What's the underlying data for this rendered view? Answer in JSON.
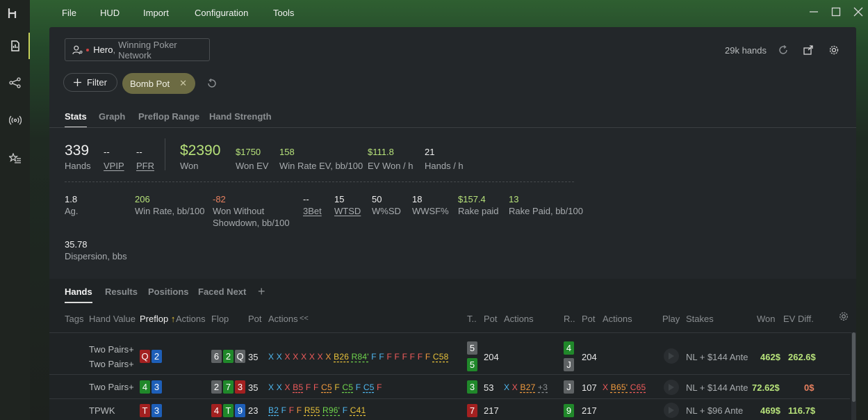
{
  "menu": {
    "file": "File",
    "hud": "HUD",
    "import": "Import",
    "configuration": "Configuration",
    "tools": "Tools"
  },
  "player": {
    "name": "Hero",
    "network": "Winning Poker Network",
    "hands_count": "29k hands"
  },
  "filter": {
    "filter_label": "Filter",
    "chip_label": "Bomb Pot"
  },
  "stats_tabs": [
    "Stats",
    "Graph",
    "Preflop Range",
    "Hand Strength"
  ],
  "stats_row1": [
    {
      "value": "339",
      "label": "Hands"
    },
    {
      "value": "--",
      "label": "VPIP"
    },
    {
      "value": "--",
      "label": "PFR"
    },
    {
      "value": "$2390",
      "label": "Won"
    },
    {
      "value": "$1750",
      "label": "Won EV"
    },
    {
      "value": "158",
      "label": "Win Rate EV, bb/100"
    },
    {
      "value": "$111.8",
      "label": "EV Won / h"
    },
    {
      "value": "21",
      "label": "Hands / h"
    }
  ],
  "stats_row2": [
    {
      "value": "1.8",
      "label": "Ag."
    },
    {
      "value": "206",
      "label": "Win Rate, bb/100"
    },
    {
      "value": "-82",
      "label": "Won Without",
      "label2": "Showdown, bb/100"
    },
    {
      "value": "--",
      "label": "3Bet"
    },
    {
      "value": "15",
      "label": "WTSD"
    },
    {
      "value": "50",
      "label": "W%SD"
    },
    {
      "value": "18",
      "label": "WWSF%"
    },
    {
      "value": "$157.4",
      "label": "Rake paid"
    },
    {
      "value": "13",
      "label": "Rake Paid, bb/100"
    }
  ],
  "stats_row3": [
    {
      "value": "35.78",
      "label": "Dispersion, bbs"
    }
  ],
  "hands_tabs": [
    "Hands",
    "Results",
    "Positions",
    "Faced Next"
  ],
  "columns": {
    "tags": "Tags",
    "hand_value": "Hand Value",
    "preflop": "Preflop",
    "preflop_sort": "↑",
    "actions1": "Actions",
    "flop": "Flop",
    "pot1": "Pot",
    "actions2": "Actions",
    "collapse": "<<",
    "turn": "T..",
    "pot2": "Pot",
    "actions3": "Actions",
    "river": "R..",
    "pot3": "Pot",
    "actions4": "Actions",
    "play": "Play",
    "stakes": "Stakes",
    "won": "Won",
    "ev_diff": "EV Diff."
  },
  "rows": [
    {
      "hand_value_a": "Two Pairs+",
      "hand_value_b": "Two Pairs+",
      "preflop": [
        {
          "r": "Q",
          "c": "red"
        },
        {
          "r": "2",
          "c": "blue"
        }
      ],
      "flop": [
        {
          "r": "6",
          "c": "gray"
        },
        {
          "r": "2",
          "c": "green"
        },
        {
          "r": "Q",
          "c": "gray"
        }
      ],
      "pot1": "35",
      "flop_actions": [
        {
          "t": "X",
          "k": "x"
        },
        {
          "t": "X",
          "k": "x"
        },
        {
          "t": "X",
          "k": "r"
        },
        {
          "t": "X",
          "k": "r"
        },
        {
          "t": "X",
          "k": "r"
        },
        {
          "t": "X",
          "k": "r"
        },
        {
          "t": "X",
          "k": "r"
        },
        {
          "t": "X",
          "k": "o"
        },
        {
          "t": "B26",
          "k": "b"
        },
        {
          "t": "R84'",
          "k": "g"
        },
        {
          "t": "F",
          "k": "x"
        },
        {
          "t": "F",
          "k": "x"
        },
        {
          "t": "F",
          "k": "r"
        },
        {
          "t": "F",
          "k": "r"
        },
        {
          "t": "F",
          "k": "r"
        },
        {
          "t": "F",
          "k": "r"
        },
        {
          "t": "F",
          "k": "r"
        },
        {
          "t": "F",
          "k": "o"
        },
        {
          "t": "C58",
          "k": "b"
        }
      ],
      "turn_a": {
        "r": "5",
        "c": "gray"
      },
      "turn_b": {
        "r": "5",
        "c": "green"
      },
      "pot2": "204",
      "river_a": {
        "r": "4",
        "c": "green"
      },
      "river_b": {
        "r": "J",
        "c": "gray"
      },
      "pot3": "204",
      "stakes": "NL + $144 Ante",
      "won": "462$",
      "ev_diff": "262.6$"
    },
    {
      "hand_value_a": "Two Pairs+",
      "preflop": [
        {
          "r": "4",
          "c": "green"
        },
        {
          "r": "3",
          "c": "blue"
        }
      ],
      "flop": [
        {
          "r": "2",
          "c": "gray"
        },
        {
          "r": "7",
          "c": "green"
        },
        {
          "r": "3",
          "c": "red"
        }
      ],
      "pot1": "35",
      "flop_actions": [
        {
          "t": "X",
          "k": "x"
        },
        {
          "t": "X",
          "k": "x"
        },
        {
          "t": "X",
          "k": "r"
        },
        {
          "t": "B5",
          "k": "r"
        },
        {
          "t": "F",
          "k": "r"
        },
        {
          "t": "F",
          "k": "r"
        },
        {
          "t": "C5",
          "k": "o"
        },
        {
          "t": "F",
          "k": "b"
        },
        {
          "t": "C5",
          "k": "g"
        },
        {
          "t": "F",
          "k": "x"
        },
        {
          "t": "C5",
          "k": "x"
        },
        {
          "t": "F",
          "k": "r"
        }
      ],
      "turn_a": {
        "r": "3",
        "c": "green"
      },
      "pot2": "53",
      "turn_actions": [
        {
          "t": "X",
          "k": "x"
        },
        {
          "t": "X",
          "k": "r"
        },
        {
          "t": "B27",
          "k": "o"
        },
        {
          "t": "+3",
          "k": "m"
        }
      ],
      "river_a": {
        "r": "J",
        "c": "gray"
      },
      "pot3": "107",
      "river_actions": [
        {
          "t": "X",
          "k": "r"
        },
        {
          "t": "B65'",
          "k": "o"
        },
        {
          "t": "C65",
          "k": "r"
        }
      ],
      "stakes": "NL + $144 Ante",
      "won": "72.62$",
      "ev_diff": "0$"
    },
    {
      "hand_value_a": "TPWK",
      "preflop": [
        {
          "r": "T",
          "c": "red"
        },
        {
          "r": "3",
          "c": "blue"
        }
      ],
      "flop": [
        {
          "r": "4",
          "c": "red"
        },
        {
          "r": "T",
          "c": "green"
        },
        {
          "r": "9",
          "c": "blue"
        }
      ],
      "pot1": "23",
      "flop_actions": [
        {
          "t": "B2",
          "k": "x"
        },
        {
          "t": "F",
          "k": "x"
        },
        {
          "t": "F",
          "k": "r"
        },
        {
          "t": "F",
          "k": "o"
        },
        {
          "t": "R55",
          "k": "b"
        },
        {
          "t": "R96'",
          "k": "g"
        },
        {
          "t": "F",
          "k": "x"
        },
        {
          "t": "C41",
          "k": "b"
        }
      ],
      "turn_a": {
        "r": "7",
        "c": "red"
      },
      "pot2": "217",
      "river_a": {
        "r": "9",
        "c": "green"
      },
      "pot3": "217",
      "stakes": "NL + $96 Ante",
      "won": "469$",
      "ev_diff": "116.7$"
    }
  ],
  "colors": {
    "accent_green": "#b7e27a",
    "negative": "#e8805f",
    "chip_bg": "#6c6b43",
    "panel_bg": "#23272a"
  }
}
